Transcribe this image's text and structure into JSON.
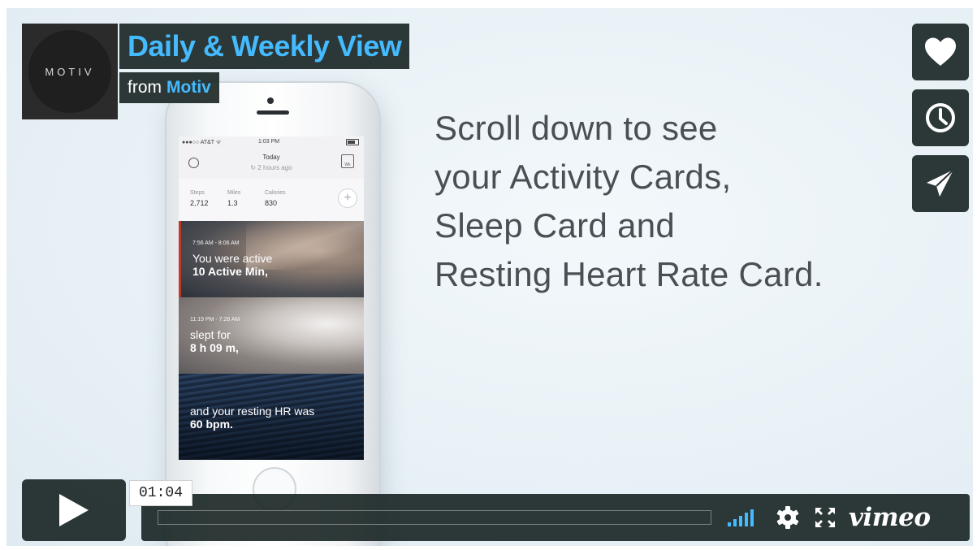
{
  "video": {
    "title": "Daily & Weekly View",
    "byline_prefix": "from",
    "owner": "Motiv",
    "logo_text": "MOTIV",
    "timecode": "01:04",
    "progress_fraction": 0.0
  },
  "side_actions": [
    {
      "icon": "heart-icon",
      "label": "Like"
    },
    {
      "icon": "clock-icon",
      "label": "Watch Later"
    },
    {
      "icon": "paper-plane-icon",
      "label": "Share"
    }
  ],
  "controls": {
    "brand": "vimeo",
    "accent": "#44bbff"
  },
  "caption": {
    "lines": [
      "Scroll down to see",
      "your Activity Cards,",
      "Sleep Card and",
      "Resting Heart Rate Card."
    ]
  },
  "phone": {
    "status": {
      "carrier": "●●●○○ AT&T ᯤ",
      "time": "1:03 PM"
    },
    "header": {
      "day": "Today",
      "sync": "↻ 2 hours ago",
      "week_label": "Wk"
    },
    "stats": [
      {
        "label": "Steps",
        "value": "2,712"
      },
      {
        "label": "Miles",
        "value": "1.3"
      },
      {
        "label": "Calories",
        "value": "830"
      }
    ],
    "add_label": "+",
    "cards": {
      "activity": {
        "time": "7:56 AM - 8:06 AM",
        "line1": "You were active",
        "line2": "10 Active Min,"
      },
      "sleep": {
        "time": "11:19 PM - 7:28 AM",
        "line1": "slept for",
        "line2": "8 h 09 m,"
      },
      "heart": {
        "line1": "and your resting HR was",
        "line2": "60 bpm."
      }
    }
  }
}
